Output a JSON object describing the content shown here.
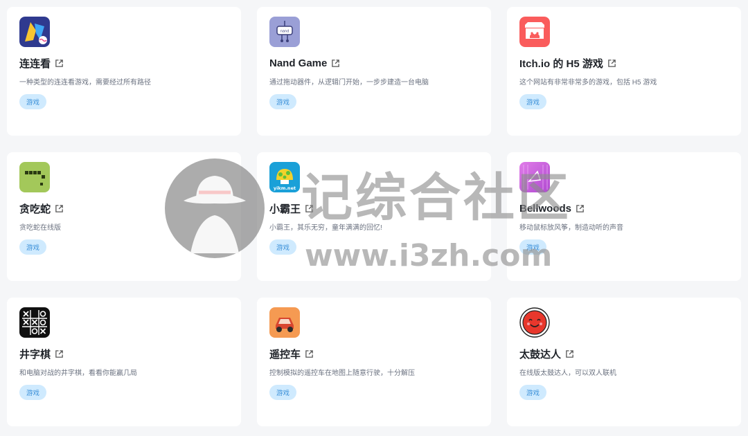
{
  "cards": [
    {
      "title": "连连看",
      "desc": "一种类型的连连看游戏，需要经过所有路径",
      "tag": "游戏",
      "icon": "lianliankan-app-icon"
    },
    {
      "title": "Nand Game",
      "desc": "通过拖动器件，从逻辑门开始，一步步建造一台电脑",
      "tag": "游戏",
      "icon": "nand-game-app-icon"
    },
    {
      "title": "Itch.io 的 H5 游戏",
      "desc": "这个网站有非常非常多的游戏，包括 H5 游戏",
      "tag": "游戏",
      "icon": "itch-io-app-icon"
    },
    {
      "title": "贪吃蛇",
      "desc": "贪吃蛇在线版",
      "tag": "游戏",
      "icon": "snake-app-icon"
    },
    {
      "title": "小霸王",
      "desc": "小霸王，其乐无穷，童年满满的回忆!",
      "tag": "游戏",
      "icon": "xiaobawang-app-icon",
      "logo_text": "yikm.net"
    },
    {
      "title": "Bellwoods",
      "desc": "移动鼠标放风筝，制造动听的声音",
      "tag": "游戏",
      "icon": "bellwoods-app-icon"
    },
    {
      "title": "井字棋",
      "desc": "和电脑对战的井字棋，看看你能赢几局",
      "tag": "游戏",
      "icon": "tic-tac-toe-app-icon"
    },
    {
      "title": "遥控车",
      "desc": "控制模拟的遥控车在地图上随意行驶，十分解压",
      "tag": "游戏",
      "icon": "rc-car-app-icon"
    },
    {
      "title": "太鼓达人",
      "desc": "在线版太鼓达人，可以双人联机",
      "tag": "游戏",
      "icon": "taiko-app-icon"
    }
  ],
  "watermark": {
    "text": "记综合社区",
    "url": "www.i3zh.com"
  },
  "colors": {
    "tag_bg": "#cfeafe",
    "tag_text": "#3a8fd8",
    "card_bg": "#ffffff",
    "page_bg": "#f5f6f8"
  }
}
